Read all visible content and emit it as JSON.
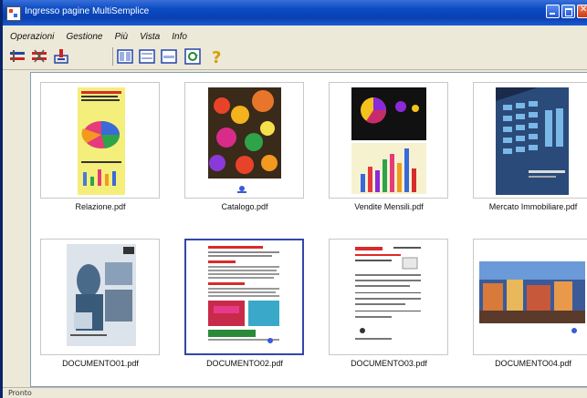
{
  "window": {
    "title": "Ingresso pagine MultiSemplice",
    "icon": "app-icon"
  },
  "menu": [
    "Operazioni",
    "Gestione",
    "Più",
    "Vista",
    "Info"
  ],
  "toolbar": {
    "buttons": [
      "copy-page-icon",
      "delete-page-icon",
      "scan-icon",
      "view-large-icon",
      "view-medium-icon",
      "view-small-icon",
      "refresh-icon",
      "help-icon"
    ]
  },
  "documents": [
    {
      "label": "Relazione.pdf",
      "selected": false
    },
    {
      "label": "Catalogo.pdf",
      "selected": false
    },
    {
      "label": "Vendite Mensili.pdf",
      "selected": false
    },
    {
      "label": "Mercato Immobiliare.pdf",
      "selected": false
    },
    {
      "label": "DOCUMENTO01.pdf",
      "selected": false
    },
    {
      "label": "DOCUMENTO02.pdf",
      "selected": true
    },
    {
      "label": "DOCUMENTO03.pdf",
      "selected": false
    },
    {
      "label": "DOCUMENTO04.pdf",
      "selected": false
    }
  ],
  "status": {
    "text": "Pronto"
  },
  "colors": {
    "titlebar": "#0a3fb0",
    "selection": "#3247a8",
    "window": "#ece9d8"
  }
}
